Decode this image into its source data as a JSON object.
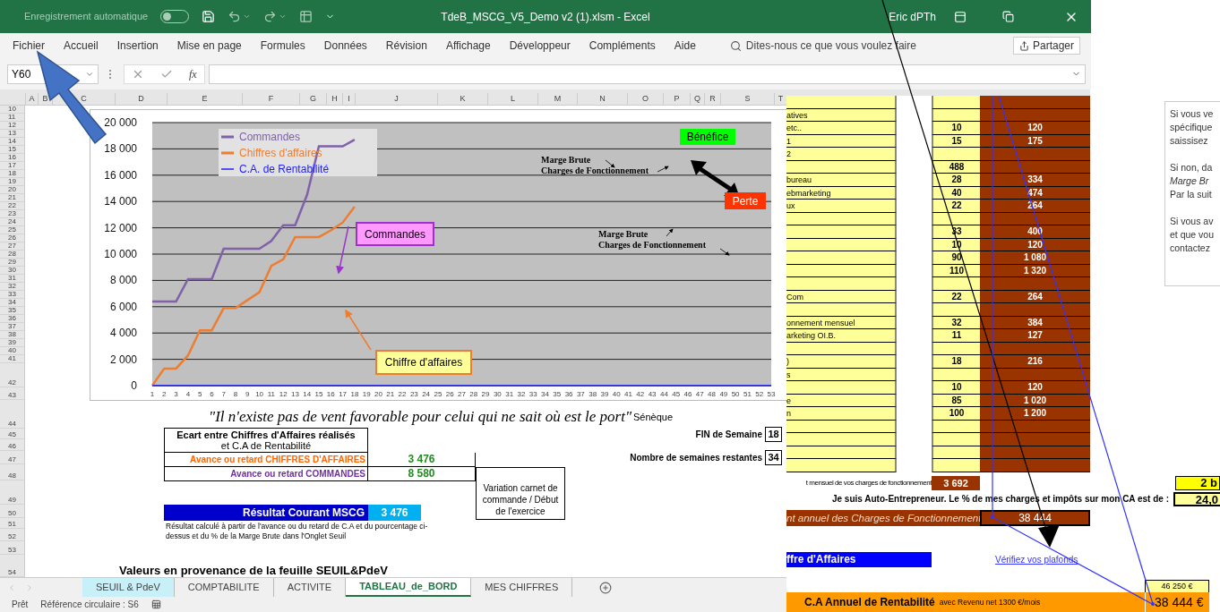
{
  "title_bar": {
    "autosave_label": "Enregistrement automatique",
    "autosave_on": false,
    "title": "TdeB_MSCG_V5_Demo v2 (1).xlsm  -  Excel",
    "user": "Eric dPTh"
  },
  "menu": [
    "Fichier",
    "Accueil",
    "Insertion",
    "Mise en page",
    "Formules",
    "Données",
    "Révision",
    "Affichage",
    "Développeur",
    "Compléments",
    "Aide"
  ],
  "search_placeholder": "Dites-nous ce que vous voulez faire",
  "share_label": "Partager",
  "formula_bar": {
    "name_box": "Y60",
    "function_label": "fx"
  },
  "columns": [
    "A",
    "B",
    "C",
    "D",
    "E",
    "F",
    "G",
    "H",
    "I",
    "J",
    "K",
    "L",
    "M",
    "N",
    "O",
    "P",
    "Q",
    "R",
    "S",
    "T"
  ],
  "row_numbers": [
    "10",
    "11",
    "12",
    "13",
    "14",
    "15",
    "16",
    "17",
    "18",
    "19",
    "20",
    "21",
    "22",
    "23",
    "24",
    "25",
    "26",
    "27",
    "28",
    "29",
    "30",
    "31",
    "32",
    "33",
    "34",
    "35",
    "36",
    "37",
    "38",
    "39",
    "40",
    "41",
    "42",
    "43",
    "44",
    "45",
    "46",
    "47",
    "48",
    "49",
    "50",
    "51",
    "52",
    "53",
    "54"
  ],
  "chart": {
    "chart_data": {
      "type": "line",
      "x": [
        1,
        2,
        3,
        4,
        5,
        6,
        7,
        8,
        9,
        10,
        11,
        12,
        13,
        14,
        15,
        16,
        17,
        18,
        19,
        20,
        21,
        22,
        23,
        24,
        25,
        26,
        27,
        28,
        29,
        30,
        31,
        32,
        33,
        34,
        35,
        36,
        37,
        38,
        39,
        40,
        41,
        42,
        43,
        44,
        45,
        46,
        47,
        48,
        49,
        50,
        51,
        52,
        53
      ],
      "series": [
        {
          "name": "Commandes",
          "color": "#7f62a8",
          "values": [
            6400,
            6400,
            6400,
            8100,
            8100,
            8100,
            10400,
            10400,
            10400,
            10400,
            11000,
            12200,
            12200,
            14500,
            18200,
            18200,
            18200,
            18700,
            null,
            null,
            null,
            null,
            null,
            null,
            null,
            null,
            null,
            null,
            null,
            null,
            null,
            null,
            null,
            null,
            null,
            null,
            null,
            null,
            null,
            null,
            null,
            null,
            null,
            null,
            null,
            null,
            null,
            null,
            null,
            null,
            null,
            null,
            null
          ]
        },
        {
          "name": "Chiffres d'affaires",
          "color": "#ed7d31",
          "values": [
            0,
            1300,
            1300,
            2300,
            4200,
            4200,
            5900,
            5900,
            6500,
            7100,
            9100,
            9600,
            11300,
            11300,
            11300,
            11800,
            12400,
            13600,
            null,
            null,
            null,
            null,
            null,
            null,
            null,
            null,
            null,
            null,
            null,
            null,
            null,
            null,
            null,
            null,
            null,
            null,
            null,
            null,
            null,
            null,
            null,
            null,
            null,
            null,
            null,
            null,
            null,
            null,
            null,
            null,
            null,
            null,
            null
          ]
        },
        {
          "name": "C.A. de Rentabilité",
          "color": "#2020ff",
          "values": [
            0,
            0,
            0,
            0,
            0,
            0,
            0,
            0,
            0,
            0,
            0,
            0,
            0,
            0,
            0,
            0,
            0,
            0,
            0,
            0,
            0,
            0,
            0,
            0,
            0,
            0,
            0,
            0,
            0,
            0,
            0,
            0,
            0,
            0,
            0,
            0,
            0,
            0,
            0,
            0,
            0,
            0,
            0,
            0,
            0,
            0,
            0,
            0,
            0,
            0,
            0,
            0,
            0
          ]
        }
      ],
      "xlim": [
        1,
        53
      ],
      "ylim": [
        0,
        20000
      ],
      "grid": true,
      "legend": "upper left",
      "yticks": [
        {
          "value": 0,
          "label": "0"
        },
        {
          "value": 2000,
          "label": "2 000"
        },
        {
          "value": 4000,
          "label": "4 000"
        },
        {
          "value": 6000,
          "label": "6 000"
        },
        {
          "value": 8000,
          "label": "8 000"
        },
        {
          "value": 10000,
          "label": "10 000"
        },
        {
          "value": 12000,
          "label": "12 000"
        },
        {
          "value": 14000,
          "label": "14 000"
        },
        {
          "value": 16000,
          "label": "16 000"
        },
        {
          "value": 18000,
          "label": "18 000"
        },
        {
          "value": 20000,
          "label": "20 000"
        }
      ],
      "xticks": [
        1,
        2,
        3,
        4,
        5,
        6,
        7,
        8,
        9,
        10,
        11,
        12,
        13,
        14,
        15,
        16,
        17,
        18,
        19,
        20,
        21,
        22,
        23,
        24,
        25,
        26,
        27,
        28,
        29,
        30,
        31,
        32,
        33,
        34,
        35,
        36,
        37,
        38,
        39,
        40,
        41,
        42,
        43,
        44,
        45,
        46,
        47,
        48,
        49,
        50,
        51,
        52,
        53
      ]
    },
    "callouts": [
      {
        "kind": "box",
        "text": "Bénéfice",
        "color": "#00ff00"
      },
      {
        "kind": "note",
        "lines": [
          "Marge Brute",
          "Charges de Fonctionnement"
        ]
      },
      {
        "kind": "box",
        "text": "Perte",
        "color": "#ff3300"
      },
      {
        "kind": "box",
        "text": "Commandes",
        "color": "#ff99ff"
      },
      {
        "kind": "note",
        "lines": [
          "Marge Brute",
          "Charges de Fonctionnement"
        ]
      },
      {
        "kind": "box",
        "text": "Chiffre d'affaires",
        "color": "#ffff99"
      }
    ]
  },
  "quote": {
    "text": "\"Il n'existe pas de vent favorable pour celui qui ne sait où est le port\"",
    "author": "Sénèque"
  },
  "gap_table": {
    "heading": "Ecart entre  Chiffres d'Affaires réalisés",
    "subheading": "et  C.A de Rentabilité",
    "rows": [
      {
        "kind": "sales",
        "label": "Avance ou retard CHIFFRES D'AFFAIRES",
        "value": "3 476"
      },
      {
        "kind": "orders",
        "label": "Avance ou retard   COMMANDES",
        "value": "8 580"
      }
    ],
    "variation_note": "Variation carnet de commande / Début de l'exercice"
  },
  "week_info": [
    {
      "label": "FIN de Semaine",
      "value": "18"
    },
    {
      "label": "Nombre de semaines restantes",
      "value": "34"
    }
  ],
  "result": {
    "label": "Résultat Courant MSCG",
    "value": "3 476",
    "note": "Résultat calculé à partir de l'avance ou du retard de C.A et du pourcentage ci-dessus et du % de la Marge Brute dans l'Onglet Seuil"
  },
  "section_title": "Valeurs en provenance de la feuille SEUIL&PdeV",
  "sheet_tabs": [
    {
      "label": "SEUIL & PdeV",
      "selected": false,
      "color": "#c8f0f8"
    },
    {
      "label": "COMPTABILITE",
      "selected": false
    },
    {
      "label": "ACTIVITE",
      "selected": false
    },
    {
      "label": "TABLEAU_de_BORD",
      "selected": true
    },
    {
      "label": "MES CHIFFRES",
      "selected": false
    }
  ],
  "status_bar": {
    "mode": "Prêt",
    "info": "Référence circulaire : S6"
  },
  "overlay_sheet": {
    "rows": [
      {},
      {
        "label": "atives"
      },
      {
        "label": "etc..",
        "count": "10",
        "amount": "120"
      },
      {
        "label": "1",
        "count": "15",
        "amount": "175"
      },
      {
        "label": "2"
      },
      {
        "count": "488"
      },
      {
        "label": "bureau",
        "count": "28",
        "amount": "334"
      },
      {
        "label": "ebmarketing",
        "count": "40",
        "amount": "474"
      },
      {
        "label": "ux",
        "count": "22",
        "amount": "264"
      },
      {},
      {
        "count": "33",
        "amount": "400"
      },
      {
        "count": "10",
        "amount": "120"
      },
      {
        "count": "90",
        "amount": "1 080"
      },
      {
        "count": "110",
        "amount": "1 320"
      },
      {},
      {
        "label": "Com",
        "count": "22",
        "amount": "264"
      },
      {},
      {
        "label": "onnement mensuel",
        "count": "32",
        "amount": "384"
      },
      {
        "label": "arketing OI.B.",
        "count": "11",
        "amount": "127"
      },
      {},
      {
        "label": ")",
        "count": "18",
        "amount": "216"
      },
      {
        "label": "s"
      },
      {
        "count": "10",
        "amount": "120"
      },
      {
        "label": "e",
        "count": "85",
        "amount": "1 020"
      },
      {
        "label": "n",
        "count": "100",
        "amount": "1 200"
      },
      {},
      {},
      {},
      {}
    ],
    "help_paragraphs": [
      [
        "Si vous ve",
        "spécifique",
        "saissisez"
      ],
      [
        "Si non, da",
        "*Marge Br*",
        "Par la suit"
      ],
      [
        "Si vous av",
        "et que vou",
        "contactez"
      ]
    ],
    "monthly_label": "t mensuel de vos charges de fonctionnement",
    "monthly_value": "3 692",
    "top_value": "2 b",
    "auto_entrepreneur_label": "Je suis Auto-Entrepreneur. Le % de mes charges et impôts sur mon CA est de :",
    "rate_value": "24,0",
    "annual_label": "nt annuel des Charges de Fonctionnement",
    "annual_value": "38 444",
    "revenue_banner": "ffre d'Affaires",
    "link": "Vérifiez vos plafonds",
    "ceiling_value": "46 250 €",
    "breakeven_label": "C.A Annuel de Rentabilité",
    "breakeven_note": "avec Revenu net 1300 €/mois",
    "breakeven_value": "38 444 €"
  }
}
